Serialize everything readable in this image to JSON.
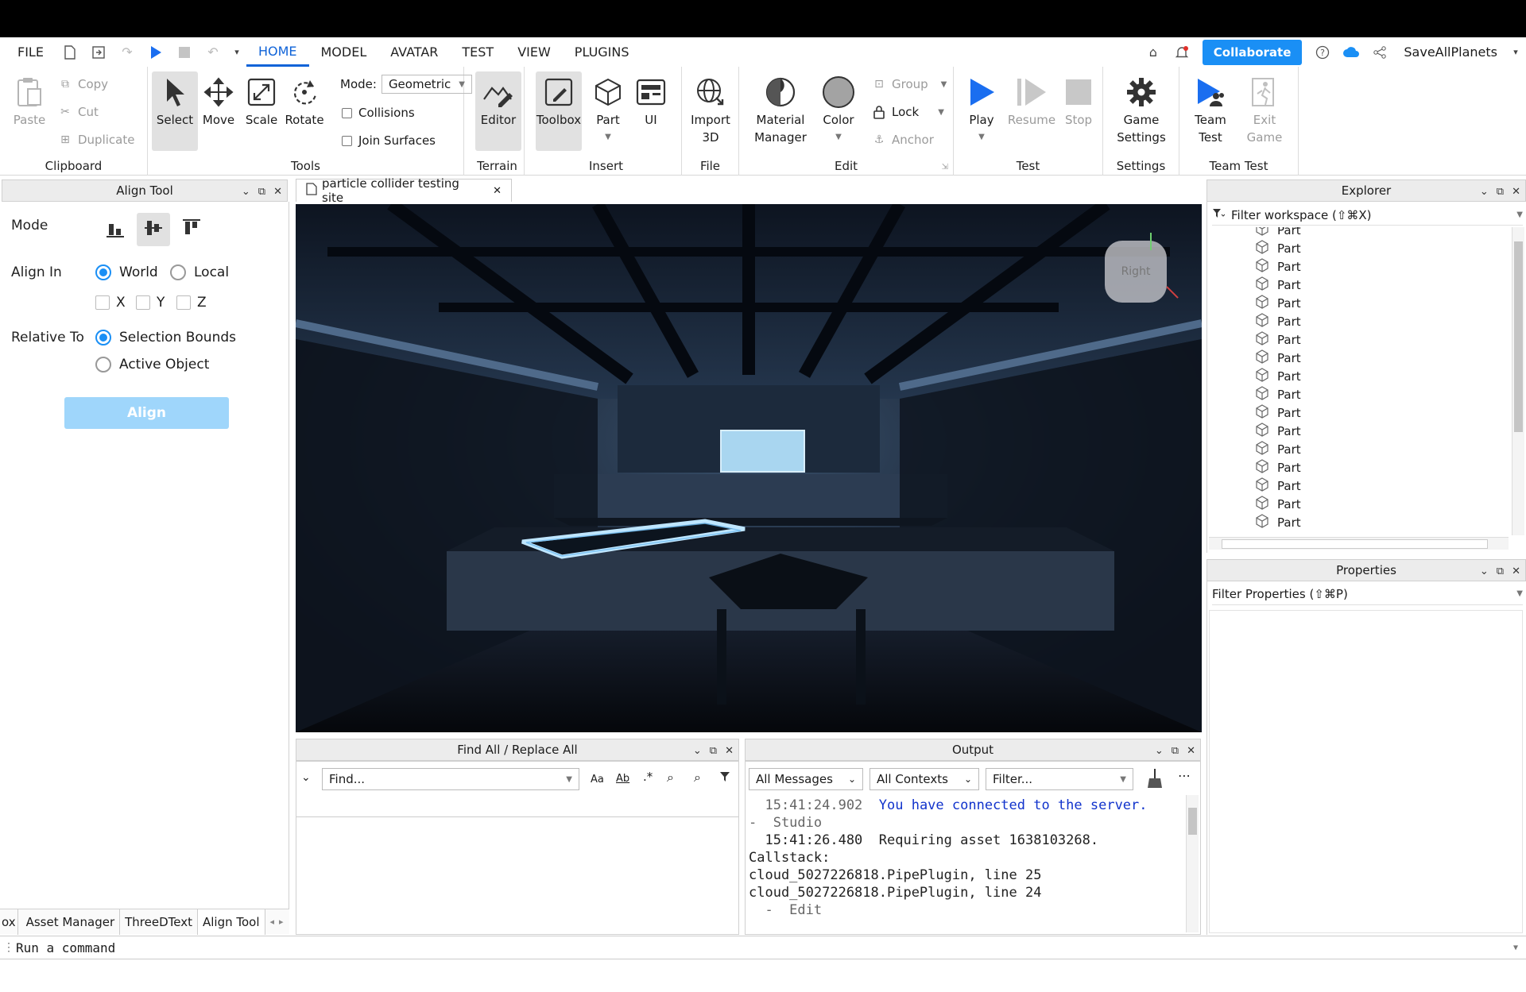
{
  "menubar": {
    "file": "FILE",
    "tabs": [
      "HOME",
      "MODEL",
      "AVATAR",
      "TEST",
      "VIEW",
      "PLUGINS"
    ],
    "active_tab": "HOME",
    "collaborate": "Collaborate",
    "username": "SaveAllPlanets"
  },
  "ribbon": {
    "clipboard": {
      "label": "Clipboard",
      "paste": "Paste",
      "copy": "Copy",
      "cut": "Cut",
      "duplicate": "Duplicate"
    },
    "tools": {
      "label": "Tools",
      "select": "Select",
      "move": "Move",
      "scale": "Scale",
      "rotate": "Rotate",
      "mode_label": "Mode:",
      "mode_value": "Geometric",
      "collisions": "Collisions",
      "join_surfaces": "Join Surfaces"
    },
    "terrain": {
      "label": "Terrain",
      "editor": "Editor"
    },
    "insert": {
      "label": "Insert",
      "toolbox": "Toolbox",
      "part": "Part",
      "ui": "UI"
    },
    "file": {
      "label": "File",
      "import_line1": "Import",
      "import_line2": "3D"
    },
    "edit": {
      "label": "Edit",
      "material_line1": "Material",
      "material_line2": "Manager",
      "color": "Color",
      "group": "Group",
      "lock": "Lock",
      "anchor": "Anchor"
    },
    "test": {
      "label": "Test",
      "play": "Play",
      "resume": "Resume",
      "stop": "Stop"
    },
    "settings": {
      "label": "Settings",
      "game_line1": "Game",
      "game_line2": "Settings"
    },
    "team_test": {
      "label": "Team Test",
      "team_line1": "Team",
      "team_line2": "Test",
      "exit_line1": "Exit",
      "exit_line2": "Game"
    }
  },
  "align_tool": {
    "title": "Align Tool",
    "mode_label": "Mode",
    "align_in_label": "Align In",
    "world": "World",
    "local": "Local",
    "x": "X",
    "y": "Y",
    "z": "Z",
    "relative_to_label": "Relative To",
    "selection_bounds": "Selection Bounds",
    "active_object": "Active Object",
    "align_button": "Align"
  },
  "bottom_tabs": [
    "ox",
    "Asset Manager",
    "ThreeDText",
    "Align Tool"
  ],
  "document_tab": "particle collider testing site",
  "viewcube_label": "Right",
  "find_panel": {
    "title": "Find All / Replace All",
    "placeholder": "Find...",
    "aa": "Aa",
    "ab": "Ab",
    "regex": ".*"
  },
  "output_panel": {
    "title": "Output",
    "messages_filter": "All Messages",
    "contexts_filter": "All Contexts",
    "filter_placeholder": "Filter...",
    "lines": [
      {
        "text": "  15:41:24.902  ",
        "style": "grey"
      },
      {
        "text": "You have connected to the server.",
        "style": "blue"
      },
      {
        "text": "-  Studio",
        "style": "grey"
      },
      {
        "text": "  15:41:26.480  Requiring asset 1638103268.",
        "style": "normal"
      },
      {
        "text": "Callstack:",
        "style": "normal"
      },
      {
        "text": "cloud_5027226818.PipePlugin, line 25",
        "style": "normal"
      },
      {
        "text": "cloud_5027226818.PipePlugin, line 24",
        "style": "normal"
      },
      {
        "text": "  -  Edit",
        "style": "grey"
      }
    ]
  },
  "explorer": {
    "title": "Explorer",
    "filter_placeholder": "Filter workspace (⇧⌘X)",
    "items": [
      "Part",
      "Part",
      "Part",
      "Part",
      "Part",
      "Part",
      "Part",
      "Part",
      "Part",
      "Part",
      "Part",
      "Part",
      "Part",
      "Part",
      "Part",
      "Part",
      "Part"
    ]
  },
  "properties": {
    "title": "Properties",
    "filter_placeholder": "Filter Properties (⇧⌘P)"
  },
  "command_bar": {
    "placeholder": "Run a command"
  },
  "colors": {
    "accent": "#1a8ff5",
    "active_tab": "#0f63d8",
    "align_button": "#9fd6fb",
    "viewport_bg": "#0b0f17"
  }
}
